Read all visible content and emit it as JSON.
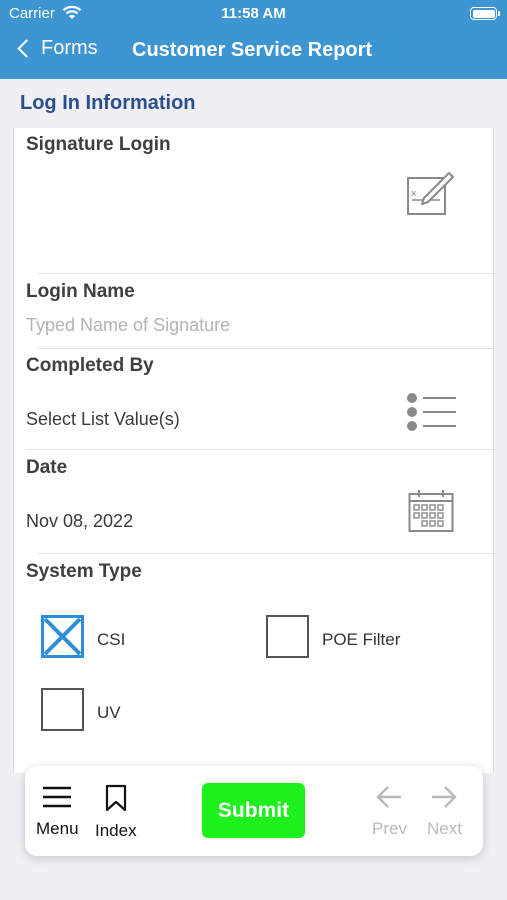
{
  "status_bar": {
    "carrier": "Carrier",
    "time": "11:58 AM"
  },
  "nav": {
    "back_label": "Forms",
    "title": "Customer Service Report"
  },
  "section": {
    "title": "Log In Information"
  },
  "fields": {
    "signature": {
      "label": "Signature Login"
    },
    "login_name": {
      "label": "Login Name",
      "placeholder": "Typed Name of Signature"
    },
    "completed_by": {
      "label": "Completed By",
      "value": "Select List Value(s)"
    },
    "date": {
      "label": "Date",
      "value": "Nov 08, 2022"
    },
    "system_type": {
      "label": "System Type",
      "options": [
        {
          "label": "CSI",
          "checked": true
        },
        {
          "label": "POE Filter",
          "checked": false
        },
        {
          "label": "UV",
          "checked": false
        }
      ]
    }
  },
  "toolbar": {
    "menu_label": "Menu",
    "index_label": "Index",
    "submit_label": "Submit",
    "prev_label": "Prev",
    "next_label": "Next"
  },
  "colors": {
    "header": "#3d95d2",
    "section_title": "#2a4f8e",
    "submit": "#1ef01e",
    "checkbox_checked": "#2e8fd8"
  }
}
